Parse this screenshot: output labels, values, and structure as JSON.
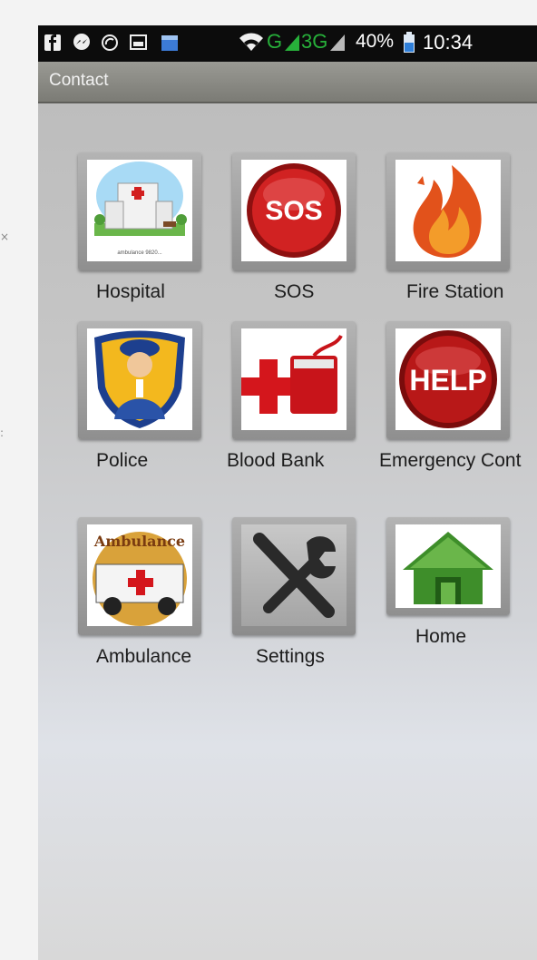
{
  "status_bar": {
    "battery": "40%",
    "time": "10:34",
    "network_g": "G",
    "network_3g": "3G",
    "icons": [
      "facebook-icon",
      "messenger-icon",
      "sync-icon",
      "gallery-icon",
      "calendar-icon",
      "wifi-icon",
      "signal-icon"
    ]
  },
  "app_bar": {
    "title": "Contact"
  },
  "tiles": [
    {
      "label": "Hospital",
      "icon": "hospital-icon",
      "sub": "ambulance 9820..."
    },
    {
      "label": "SOS",
      "icon": "sos-icon",
      "glyph": "SOS"
    },
    {
      "label": "Fire Station",
      "icon": "fire-icon"
    },
    {
      "label": "Police",
      "icon": "police-icon"
    },
    {
      "label": "Blood Bank",
      "icon": "blood-bank-icon"
    },
    {
      "label": "Emergency Cont",
      "icon": "help-icon",
      "glyph": "HELP"
    },
    {
      "label": "Ambulance",
      "icon": "ambulance-icon",
      "glyph": "Ambulance"
    },
    {
      "label": "Settings",
      "icon": "tools-icon"
    },
    {
      "label": "Home",
      "icon": "home-icon"
    }
  ],
  "colors": {
    "titlebar": "#8a8a84",
    "sos_red": "#c4161c",
    "help_red": "#b01010",
    "home_green": "#3e8e2a"
  }
}
